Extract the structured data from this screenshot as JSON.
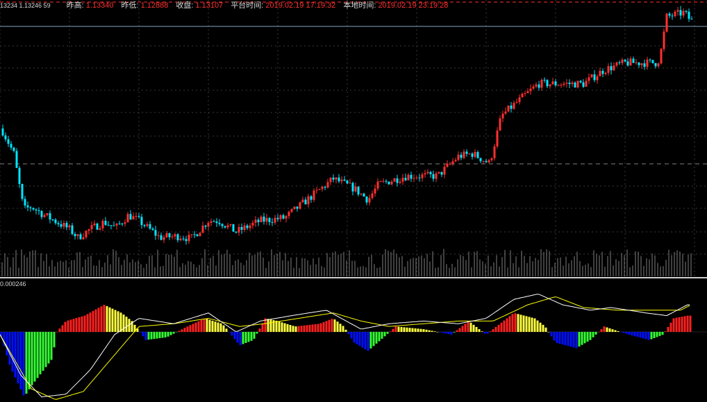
{
  "header": {
    "quote": "13234 1.13246  59",
    "items": [
      {
        "label": "昨高:",
        "value": "1.13340"
      },
      {
        "label": "昨低:",
        "value": "1.12888"
      },
      {
        "label": "收盘:",
        "value": "1.13107"
      },
      {
        "label": "平台时间:",
        "value": "2019.02.19 17:19:32"
      },
      {
        "label": "本地时间:",
        "value": "2019.02.19 23:19:28"
      }
    ]
  },
  "indicator": {
    "label": "0.000246"
  },
  "colors": {
    "background": "#000000",
    "grid": "#3a3a3a",
    "up_candle": "#ff3030",
    "down_candle": "#00e5ff",
    "volume": "#808080",
    "hist_red": "#ff2020",
    "hist_yellow": "#ffff40",
    "hist_green": "#33ff33",
    "hist_blue": "#0010ff",
    "line_white": "#ffffff",
    "line_yellow": "#ffff00"
  },
  "chart_data": [
    {
      "type": "candlestick",
      "title": "",
      "price_levels": {
        "prev_high": 1.1334,
        "prev_low": 1.12888,
        "close": 1.13107
      },
      "price_path": [
        [
          0,
          1.13
        ],
        [
          20,
          1.128
        ],
        [
          34,
          1.124
        ],
        [
          45,
          1.1242
        ],
        [
          64,
          1.1236
        ],
        [
          100,
          1.1226
        ],
        [
          112,
          1.122
        ],
        [
          130,
          1.1226
        ],
        [
          150,
          1.1231
        ],
        [
          167,
          1.1227
        ],
        [
          185,
          1.1236
        ],
        [
          200,
          1.1232
        ],
        [
          230,
          1.122
        ],
        [
          260,
          1.1221
        ],
        [
          275,
          1.1219
        ],
        [
          300,
          1.1232
        ],
        [
          315,
          1.1232
        ],
        [
          340,
          1.1224
        ],
        [
          375,
          1.1232
        ],
        [
          410,
          1.1234
        ],
        [
          430,
          1.1242
        ],
        [
          470,
          1.1258
        ],
        [
          480,
          1.1262
        ],
        [
          510,
          1.1255
        ],
        [
          530,
          1.1247
        ],
        [
          545,
          1.1258
        ],
        [
          585,
          1.1264
        ],
        [
          630,
          1.1264
        ],
        [
          660,
          1.1278
        ],
        [
          680,
          1.128
        ],
        [
          705,
          1.1273
        ],
        [
          722,
          1.1307
        ],
        [
          740,
          1.1315
        ],
        [
          775,
          1.133
        ],
        [
          800,
          1.133
        ],
        [
          840,
          1.133
        ],
        [
          870,
          1.134
        ],
        [
          900,
          1.1345
        ],
        [
          945,
          1.1345
        ],
        [
          950,
          1.1348
        ],
        [
          960,
          1.1378
        ],
        [
          985,
          1.1381
        ],
        [
          995,
          1.1375
        ]
      ],
      "volume_range": [
        0.3,
        1.0
      ]
    },
    {
      "type": "bar",
      "title": "",
      "ylim": [
        -0.000246,
        0.000246
      ],
      "histogram_path": [
        [
          0,
          0
        ],
        [
          15,
          -0.00013
        ],
        [
          35,
          -0.00024
        ],
        [
          45,
          -0.0002
        ],
        [
          75,
          -0.0001
        ],
        [
          82,
          0
        ],
        [
          95,
          4e-05
        ],
        [
          122,
          6e-05
        ],
        [
          150,
          0.0001
        ],
        [
          175,
          7e-05
        ],
        [
          190,
          4e-05
        ],
        [
          210,
          -3e-05
        ],
        [
          240,
          -2e-05
        ],
        [
          270,
          2e-05
        ],
        [
          295,
          5e-05
        ],
        [
          320,
          3e-05
        ],
        [
          330,
          0
        ],
        [
          345,
          -5e-05
        ],
        [
          365,
          -3e-05
        ],
        [
          382,
          5e-05
        ],
        [
          400,
          4e-05
        ],
        [
          425,
          2e-05
        ],
        [
          460,
          3e-05
        ],
        [
          480,
          5e-05
        ],
        [
          495,
          2e-05
        ],
        [
          510,
          -4e-05
        ],
        [
          530,
          -7e-05
        ],
        [
          548,
          -3e-05
        ],
        [
          570,
          2e-05
        ],
        [
          610,
          1e-05
        ],
        [
          650,
          -1e-05
        ],
        [
          675,
          4e-05
        ],
        [
          700,
          -1e-05
        ],
        [
          720,
          3e-05
        ],
        [
          740,
          7e-05
        ],
        [
          770,
          5e-05
        ],
        [
          785,
          2e-05
        ],
        [
          800,
          -4e-05
        ],
        [
          830,
          -6e-05
        ],
        [
          850,
          -3e-05
        ],
        [
          870,
          2e-05
        ],
        [
          905,
          -1e-05
        ],
        [
          935,
          -3e-05
        ],
        [
          955,
          -1e-05
        ],
        [
          970,
          5e-05
        ],
        [
          990,
          6e-05
        ]
      ],
      "white_line": [
        [
          0,
          -1e-05
        ],
        [
          30,
          -0.00016
        ],
        [
          60,
          -0.00024
        ],
        [
          95,
          -0.00023
        ],
        [
          130,
          -0.00014
        ],
        [
          165,
          -1e-05
        ],
        [
          200,
          5e-05
        ],
        [
          250,
          3e-05
        ],
        [
          300,
          7e-05
        ],
        [
          340,
          0
        ],
        [
          375,
          4e-05
        ],
        [
          420,
          6e-05
        ],
        [
          470,
          8e-05
        ],
        [
          520,
          1e-05
        ],
        [
          560,
          3e-05
        ],
        [
          610,
          4e-05
        ],
        [
          660,
          3e-05
        ],
        [
          700,
          5e-05
        ],
        [
          740,
          0.00012
        ],
        [
          775,
          0.00014
        ],
        [
          810,
          0.0001
        ],
        [
          850,
          8e-05
        ],
        [
          880,
          9e-05
        ],
        [
          930,
          7e-05
        ],
        [
          960,
          6e-05
        ],
        [
          990,
          0.0001
        ]
      ],
      "yellow_line": [
        [
          0,
          -1e-05
        ],
        [
          45,
          -0.00021
        ],
        [
          80,
          -0.00025
        ],
        [
          120,
          -0.00022
        ],
        [
          160,
          -0.0001
        ],
        [
          200,
          2e-05
        ],
        [
          250,
          3e-05
        ],
        [
          300,
          5e-05
        ],
        [
          345,
          2e-05
        ],
        [
          380,
          3e-05
        ],
        [
          430,
          5e-05
        ],
        [
          480,
          7e-05
        ],
        [
          520,
          4e-05
        ],
        [
          560,
          2e-05
        ],
        [
          610,
          3e-05
        ],
        [
          660,
          4e-05
        ],
        [
          710,
          4e-05
        ],
        [
          760,
          0.0001
        ],
        [
          800,
          0.00013
        ],
        [
          840,
          9e-05
        ],
        [
          890,
          8e-05
        ],
        [
          940,
          8e-05
        ],
        [
          980,
          8e-05
        ],
        [
          995,
          0.0001
        ]
      ]
    }
  ]
}
